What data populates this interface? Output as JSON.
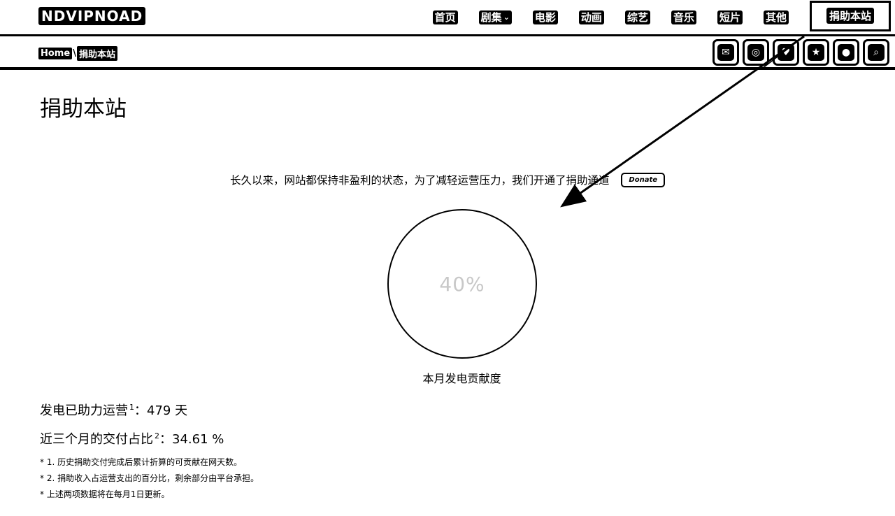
{
  "header": {
    "logo": "NDVIPNOAD",
    "nav": [
      {
        "label": "首页"
      },
      {
        "label": "剧集",
        "has_dropdown": true
      },
      {
        "label": "电影"
      },
      {
        "label": "动画"
      },
      {
        "label": "综艺"
      },
      {
        "label": "音乐"
      },
      {
        "label": "短片"
      },
      {
        "label": "其他"
      }
    ],
    "active_nav": "捐助本站"
  },
  "breadcrumb": {
    "home": "Home",
    "separator": "\\",
    "current": "捐助本站"
  },
  "toolbar_icons": [
    {
      "name": "mail-icon",
      "glyph": "✉"
    },
    {
      "name": "weibo-icon",
      "glyph": "◎"
    },
    {
      "name": "heart-icon",
      "glyph": "♥"
    },
    {
      "name": "star-icon",
      "glyph": "★"
    },
    {
      "name": "user-icon",
      "glyph": "●"
    },
    {
      "name": "search-icon",
      "glyph": "⌕"
    }
  ],
  "main": {
    "title": "捐助本站",
    "intro_text": "长久以来，网站都保持非盈利的状态，为了减轻运营压力，我们开通了捐助通道",
    "donate_label": "Donate",
    "gauge": {
      "percent_text": "40%",
      "percent": 40,
      "label": "本月发电贡献度"
    },
    "stats": {
      "days_label": "发电已助力运营",
      "days_sup": "1",
      "days_value": "：479 天",
      "ratio_label": "近三个月的交付占比",
      "ratio_sup": "2",
      "ratio_value": "：34.61 %"
    },
    "notes": [
      "* 1. 历史捐助交付完成后累计折算的可贡献在网天数。",
      "* 2. 捐助收入占运营支出的百分比，剩余部分由平台承担。",
      "* 上述两项数据将在每月1日更新。"
    ]
  }
}
